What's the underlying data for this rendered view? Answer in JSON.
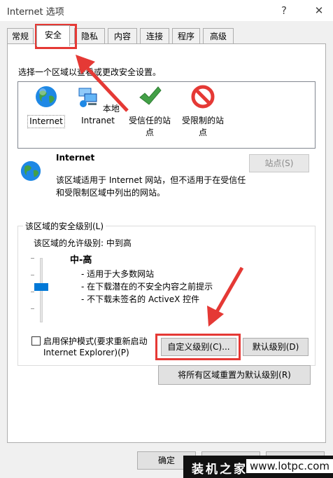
{
  "window": {
    "title": "Internet 选项",
    "help_glyph": "?",
    "close_glyph": "✕"
  },
  "tabs": [
    "常规",
    "安全",
    "隐私",
    "内容",
    "连接",
    "程序",
    "高级"
  ],
  "security": {
    "select_zone_text": "选择一个区域以查看或更改安全设置。",
    "zones": [
      {
        "label": "Internet",
        "icon": "globe-icon"
      },
      {
        "label": "本地\nIntranet",
        "icon": "network-icon"
      },
      {
        "label": "受信任的站\n点",
        "icon": "checkmark-icon"
      },
      {
        "label": "受限制的站\n点",
        "icon": "restricted-icon"
      }
    ],
    "zone_title": "Internet",
    "zone_desc_line1": "该区域适用于 Internet 网站，但不适用于在受信任",
    "zone_desc_line2": "和受限制区域中列出的网站。",
    "sites_button": "站点(S)",
    "group_label": "该区域的安全级别(L)",
    "allowed_levels": "该区域的允许级别: 中到高",
    "level_name": "中-高",
    "level_bullets": [
      "- 适用于大多数网站",
      "- 在下载潜在的不安全内容之前提示",
      "- 不下载未签名的 ActiveX 控件"
    ],
    "protected_mode_line1": "启用保护模式(要求重新启动",
    "protected_mode_line2": "Internet Explorer)(P)",
    "protected_mode_checked": false,
    "custom_level_button": "自定义级别(C)...",
    "default_level_button": "默认级别(D)",
    "reset_all_button": "将所有区域重置为默认级别(R)"
  },
  "footer": {
    "ok_button": "确定"
  },
  "watermark": {
    "text1": "装机之家",
    "text2": "www.lotpc.com"
  },
  "colors": {
    "accent": "#0078d7",
    "annotation_red": "#e53935"
  }
}
